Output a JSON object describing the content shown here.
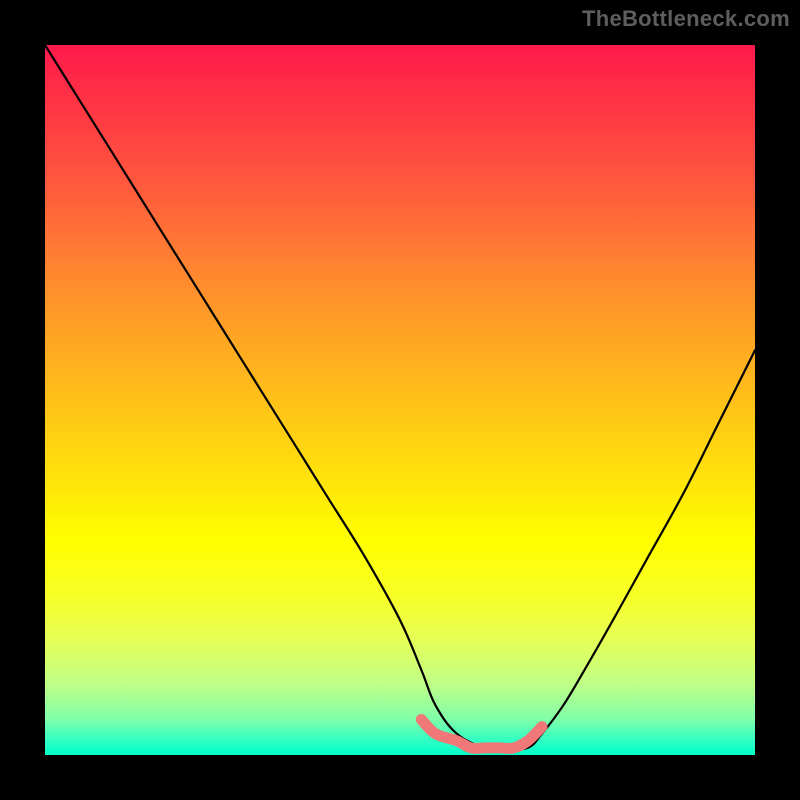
{
  "watermark": {
    "text": "TheBottleneck.com"
  },
  "chart_data": {
    "type": "line",
    "title": "",
    "xlabel": "",
    "ylabel": "",
    "xlim": [
      0,
      100
    ],
    "ylim": [
      0,
      100
    ],
    "grid": false,
    "legend": false,
    "annotations": [],
    "series": [
      {
        "name": "black-curve",
        "color": "#000000",
        "x": [
          0,
          5,
          10,
          15,
          20,
          25,
          30,
          35,
          40,
          45,
          50,
          53,
          55,
          58,
          62,
          65,
          68,
          70,
          73,
          76,
          80,
          85,
          90,
          95,
          100
        ],
        "values": [
          100,
          92,
          84,
          76,
          68,
          60,
          52,
          44,
          36,
          28,
          19,
          12,
          7,
          3,
          1,
          1,
          1,
          3,
          7,
          12,
          19,
          28,
          37,
          47,
          57
        ]
      },
      {
        "name": "pink-segment",
        "color": "#f07878",
        "x": [
          53,
          55,
          58,
          60,
          62,
          64,
          66,
          68,
          70
        ],
        "values": [
          5,
          3,
          2,
          1,
          1,
          1,
          1,
          2,
          4
        ]
      }
    ]
  }
}
